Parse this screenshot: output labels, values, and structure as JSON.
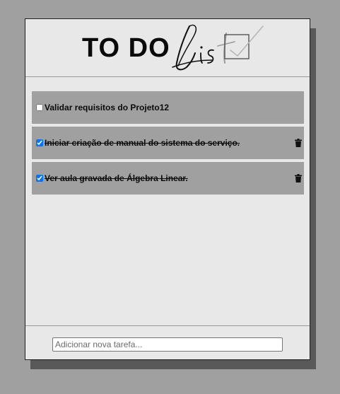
{
  "header": {
    "logo_main": "TO DO",
    "logo_script": "List"
  },
  "tasks": [
    {
      "label": "Validar requisitos do Projeto12",
      "done": false,
      "has_delete": false
    },
    {
      "label": "Iniciar criação de manual do sistema do serviço.",
      "done": true,
      "has_delete": true
    },
    {
      "label": "Ver aula gravada de Álgebra Linear.",
      "done": true,
      "has_delete": true
    }
  ],
  "footer": {
    "new_task_placeholder": "Adicionar nova tarefa..."
  },
  "icons": {
    "delete": "trash-icon"
  },
  "colors": {
    "page_bg": "#a0a0a0",
    "card_bg": "#e8e8e8",
    "item_bg": "#a0a0a0",
    "shadow": "#595959",
    "checkbox_checked": "#0a6cff"
  }
}
